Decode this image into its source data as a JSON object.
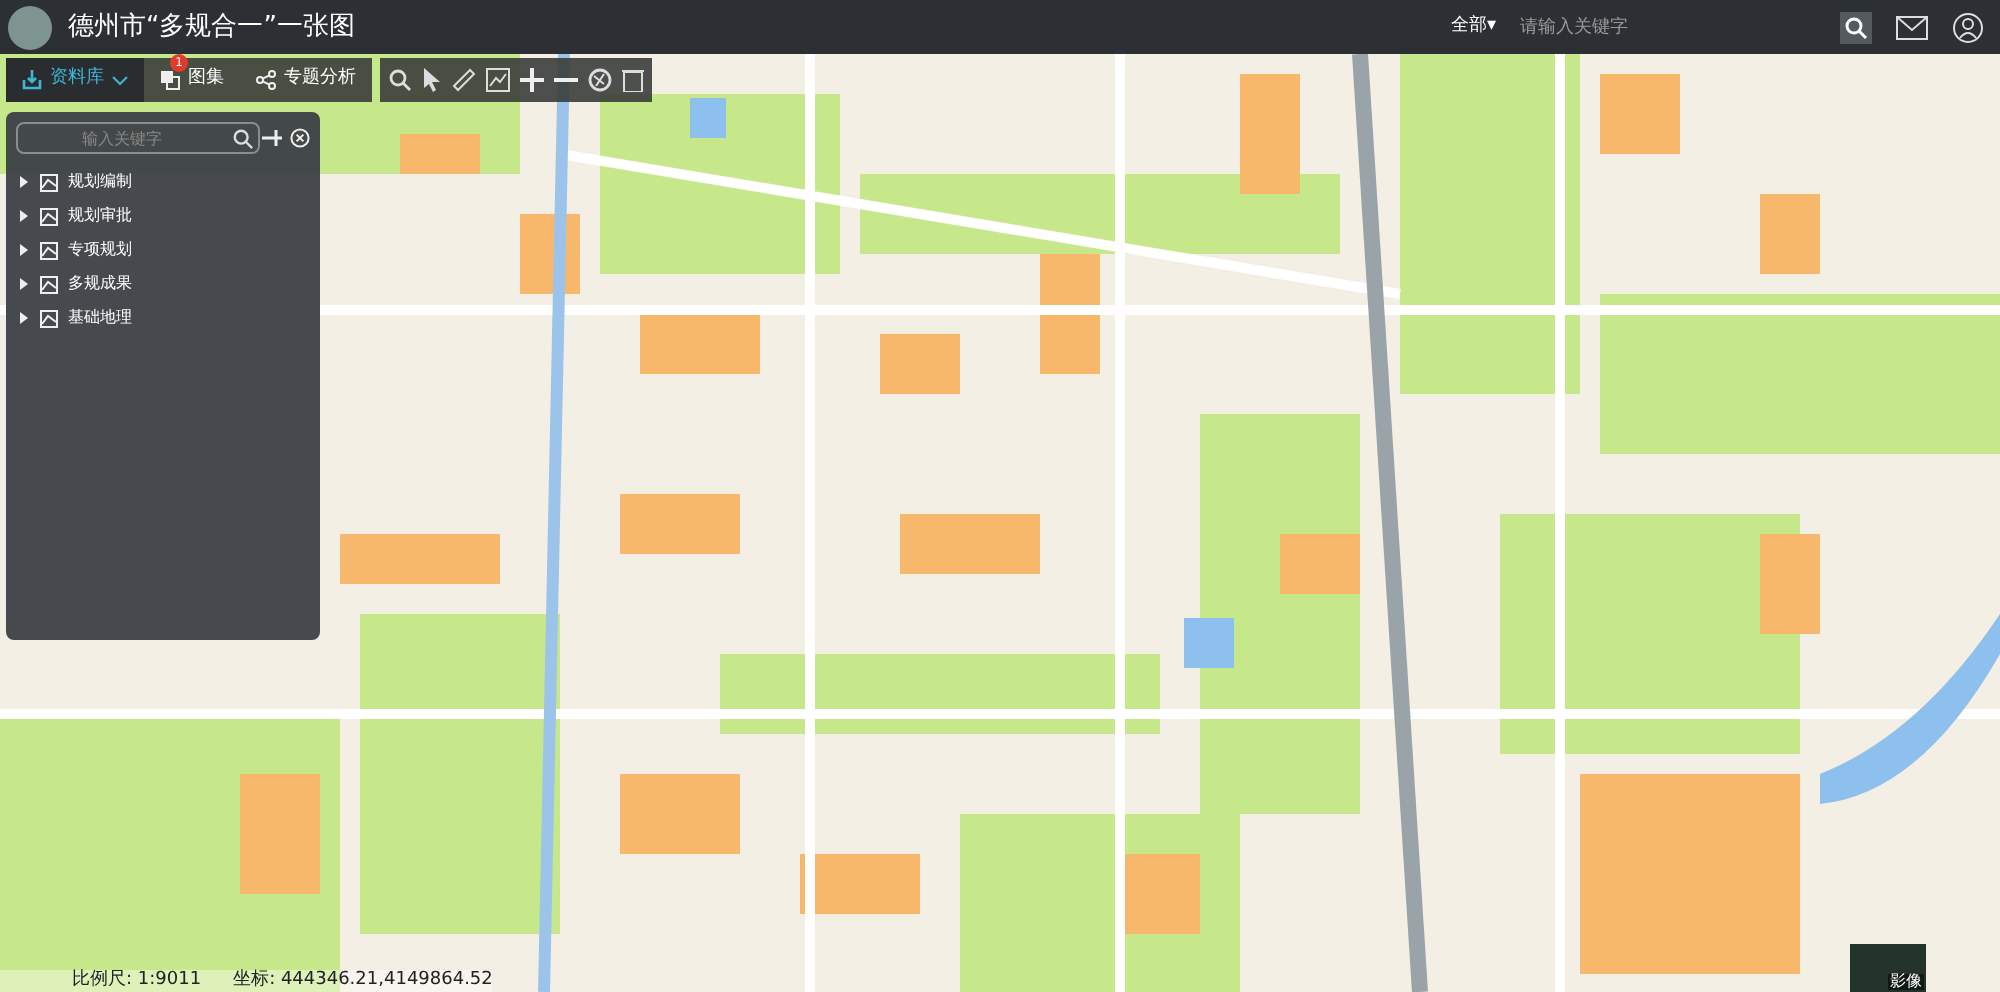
{
  "header": {
    "title": "德州市“多规合一”一张图",
    "search_scope": "全部▾",
    "search": {
      "placeholder": "请输入关键字"
    }
  },
  "toolbar": {
    "tabs": [
      {
        "label": "资料库",
        "selected": true
      },
      {
        "label": "图集",
        "selected": false,
        "badge": "1"
      },
      {
        "label": "专题分析",
        "selected": false
      }
    ]
  },
  "layer_panel": {
    "search": {
      "placeholder": "输入关键字"
    },
    "items": [
      {
        "label": "规划编制",
        "expanded": false
      },
      {
        "label": "规划审批",
        "expanded": false
      },
      {
        "label": "专项规划",
        "expanded": false
      },
      {
        "label": "多规成果",
        "expanded": false
      },
      {
        "label": "基础地理",
        "expanded": false
      }
    ]
  },
  "status_bar": {
    "scale": "比例尺: 1:9011",
    "coords": "坐标: 444346.21,4149864.52"
  },
  "basemap_switch": {
    "label": "影像",
    "selected": false
  }
}
